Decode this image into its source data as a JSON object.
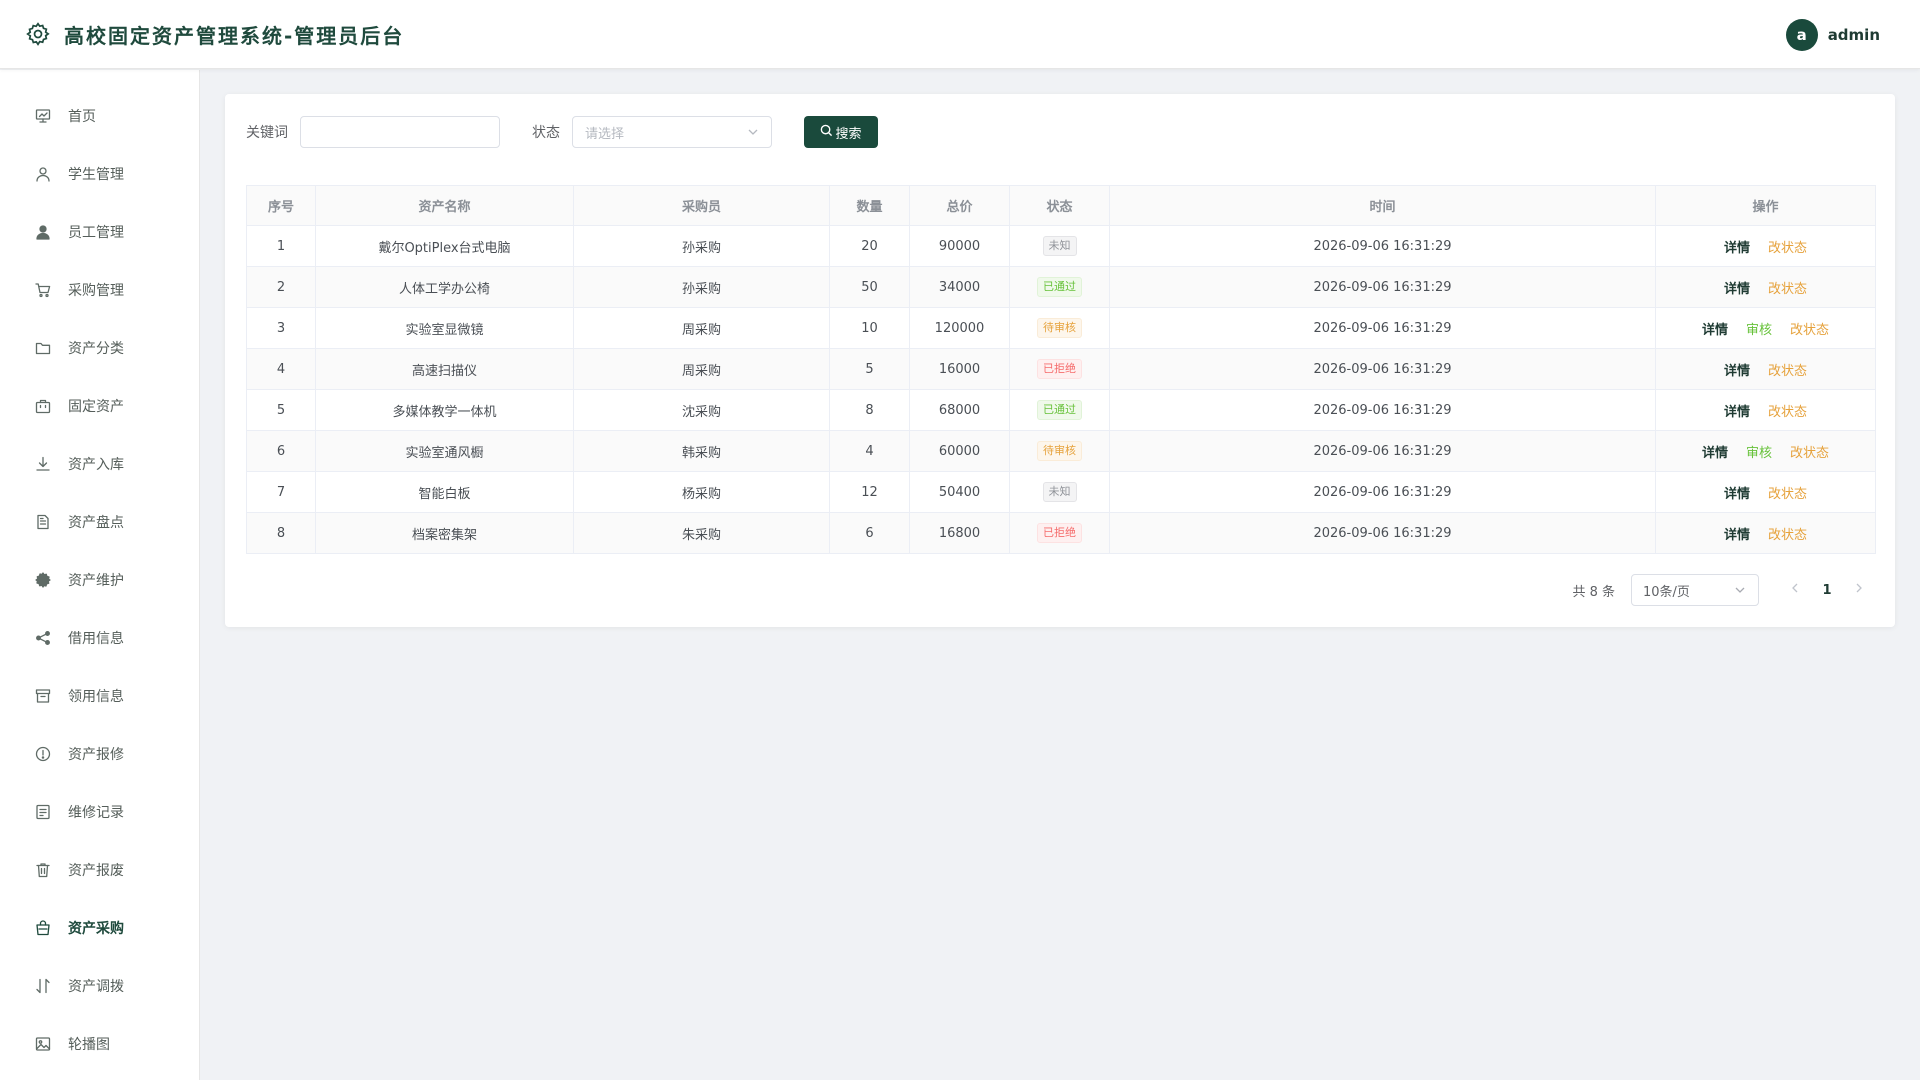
{
  "header": {
    "title": "高校固定资产管理系统-管理员后台",
    "avatar_letter": "a",
    "username": "admin"
  },
  "sidebar": {
    "items": [
      {
        "label": "首页",
        "icon": "dashboard-icon"
      },
      {
        "label": "学生管理",
        "icon": "user-outline-icon"
      },
      {
        "label": "员工管理",
        "icon": "user-filled-icon"
      },
      {
        "label": "采购管理",
        "icon": "cart-icon"
      },
      {
        "label": "资产分类",
        "icon": "folder-icon"
      },
      {
        "label": "固定资产",
        "icon": "briefcase-icon"
      },
      {
        "label": "资产入库",
        "icon": "download-icon"
      },
      {
        "label": "资产盘点",
        "icon": "document-icon"
      },
      {
        "label": "资产维护",
        "icon": "gear-icon"
      },
      {
        "label": "借用信息",
        "icon": "share-icon"
      },
      {
        "label": "领用信息",
        "icon": "box-icon"
      },
      {
        "label": "资产报修",
        "icon": "warning-circle-icon"
      },
      {
        "label": "维修记录",
        "icon": "notebook-icon"
      },
      {
        "label": "资产报废",
        "icon": "trash-icon"
      },
      {
        "label": "资产采购",
        "icon": "shopping-bag-icon",
        "active": true
      },
      {
        "label": "资产调拨",
        "icon": "sort-icon"
      },
      {
        "label": "轮播图",
        "icon": "picture-icon"
      }
    ]
  },
  "filter": {
    "keyword_label": "关键词",
    "keyword_value": "",
    "status_label": "状态",
    "status_placeholder": "请选择",
    "search_label": "搜索"
  },
  "table": {
    "headers": [
      "序号",
      "资产名称",
      "采购员",
      "数量",
      "总价",
      "状态",
      "时间",
      "操作"
    ],
    "rows": [
      {
        "no": "1",
        "name": "戴尔OptiPlex台式电脑",
        "buyer": "孙采购",
        "qty": "20",
        "total": "90000",
        "status": "未知",
        "status_color": "gray",
        "time": "2026-09-06 16:31:29",
        "actions": [
          "详情",
          "改状态"
        ]
      },
      {
        "no": "2",
        "name": "人体工学办公椅",
        "buyer": "孙采购",
        "qty": "50",
        "total": "34000",
        "status": "已通过",
        "status_color": "green",
        "time": "2026-09-06 16:31:29",
        "actions": [
          "详情",
          "改状态"
        ]
      },
      {
        "no": "3",
        "name": "实验室显微镜",
        "buyer": "周采购",
        "qty": "10",
        "total": "120000",
        "status": "待审核",
        "status_color": "orange",
        "time": "2026-09-06 16:31:29",
        "actions": [
          "详情",
          "审核",
          "改状态"
        ]
      },
      {
        "no": "4",
        "name": "高速扫描仪",
        "buyer": "周采购",
        "qty": "5",
        "total": "16000",
        "status": "已拒绝",
        "status_color": "red",
        "time": "2026-09-06 16:31:29",
        "actions": [
          "详情",
          "改状态"
        ]
      },
      {
        "no": "5",
        "name": "多媒体教学一体机",
        "buyer": "沈采购",
        "qty": "8",
        "total": "68000",
        "status": "已通过",
        "status_color": "green",
        "time": "2026-09-06 16:31:29",
        "actions": [
          "详情",
          "改状态"
        ]
      },
      {
        "no": "6",
        "name": "实验室通风橱",
        "buyer": "韩采购",
        "qty": "4",
        "total": "60000",
        "status": "待审核",
        "status_color": "orange",
        "time": "2026-09-06 16:31:29",
        "actions": [
          "详情",
          "审核",
          "改状态"
        ]
      },
      {
        "no": "7",
        "name": "智能白板",
        "buyer": "杨采购",
        "qty": "12",
        "total": "50400",
        "status": "未知",
        "status_color": "gray",
        "time": "2026-09-06 16:31:29",
        "actions": [
          "详情",
          "改状态"
        ]
      },
      {
        "no": "8",
        "name": "档案密集架",
        "buyer": "朱采购",
        "qty": "6",
        "total": "16800",
        "status": "已拒绝",
        "status_color": "red",
        "time": "2026-09-06 16:31:29",
        "actions": [
          "详情",
          "改状态"
        ]
      }
    ]
  },
  "pagination": {
    "total_text": "共 8 条",
    "page_size": "10条/页",
    "current_page": "1"
  },
  "colors": {
    "brand": "#1a4a3c",
    "success": "#67c23a",
    "warning": "#e6a23c",
    "danger": "#f56c6c",
    "info": "#909399"
  }
}
